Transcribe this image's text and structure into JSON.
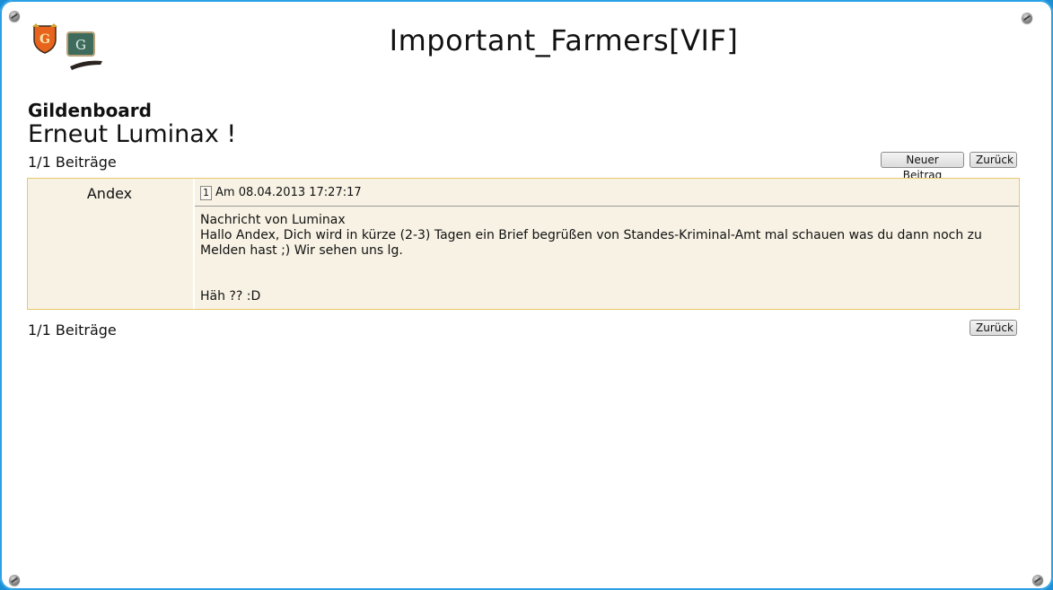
{
  "header": {
    "title": "Important_Farmers[VIF]",
    "logo_letter": "G"
  },
  "section": "Gildenboard",
  "thread": {
    "title": "Erneut Luminax !",
    "count_top": "1/1 Beiträge",
    "count_bottom": "1/1 Beiträge"
  },
  "buttons": {
    "new_post": "Neuer Beitrag",
    "back": "Zurück"
  },
  "post": {
    "author": "Andex",
    "number": "1",
    "date": "Am 08.04.2013 17:27:17",
    "line1": "Nachricht von Luminax",
    "line2": "Hallo Andex, Dich wird in kürze (2-3) Tagen ein Brief begrüßen von Standes-Kriminal-Amt mal schauen was du dann noch zu Melden hast ;) Wir sehen uns lg.",
    "line3": "Häh ?? :D"
  }
}
